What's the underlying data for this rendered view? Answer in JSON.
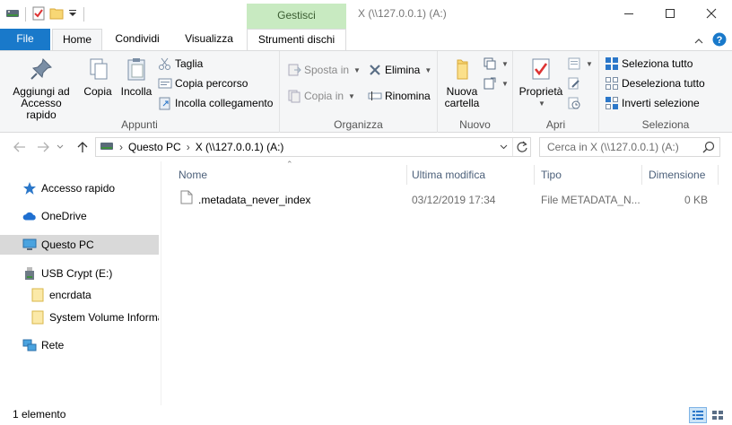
{
  "titlebar": {
    "context_header": "Gestisci",
    "title": "X (\\\\127.0.0.1) (A:)"
  },
  "tabs": {
    "file": "File",
    "home": "Home",
    "condividi": "Condividi",
    "visualizza": "Visualizza",
    "strumenti": "Strumenti dischi"
  },
  "ribbon": {
    "appunti": {
      "label": "Appunti",
      "aggiungi": "Aggiungi ad Accesso rapido",
      "aggiungi_l1": "Aggiungi ad",
      "aggiungi_l2": "Accesso rapido",
      "copia": "Copia",
      "incolla": "Incolla",
      "taglia": "Taglia",
      "copia_percorso": "Copia percorso",
      "incolla_collegamento": "Incolla collegamento"
    },
    "organizza": {
      "label": "Organizza",
      "sposta_in": "Sposta in",
      "copia_in": "Copia in",
      "elimina": "Elimina",
      "rinomina": "Rinomina"
    },
    "nuovo": {
      "label": "Nuovo",
      "nuova_cartella_l1": "Nuova",
      "nuova_cartella_l2": "cartella"
    },
    "apri": {
      "label": "Apri",
      "proprieta": "Proprietà"
    },
    "seleziona": {
      "label": "Seleziona",
      "tutto": "Seleziona tutto",
      "deseleziona": "Deseleziona tutto",
      "inverti": "Inverti selezione"
    }
  },
  "address": {
    "crumb_pc": "Questo PC",
    "crumb_drive": "X (\\\\127.0.0.1) (A:)",
    "search_placeholder": "Cerca in X (\\\\127.0.0.1) (A:)"
  },
  "nav": {
    "items": [
      {
        "label": "Accesso rapido",
        "icon": "star-icon"
      },
      {
        "label": "OneDrive",
        "icon": "cloud-icon"
      },
      {
        "label": "Questo PC",
        "icon": "computer-icon"
      },
      {
        "label": "USB Crypt (E:)",
        "icon": "usb-drive-icon"
      },
      {
        "label": "encrdata",
        "icon": "folder-icon"
      },
      {
        "label": "System Volume Informa",
        "icon": "folder-icon"
      },
      {
        "label": "Rete",
        "icon": "network-icon"
      }
    ]
  },
  "columns": {
    "nome": "Nome",
    "ultima_modifica": "Ultima modifica",
    "tipo": "Tipo",
    "dimensione": "Dimensione"
  },
  "files": [
    {
      "name": ".metadata_never_index",
      "modified": "03/12/2019 17:34",
      "type": "File METADATA_N...",
      "size": "0 KB"
    }
  ],
  "status": {
    "count": "1 elemento"
  },
  "colors": {
    "accent": "#1979ca",
    "context_tab": "#c8eac1",
    "selection": "#d9d9d9"
  }
}
